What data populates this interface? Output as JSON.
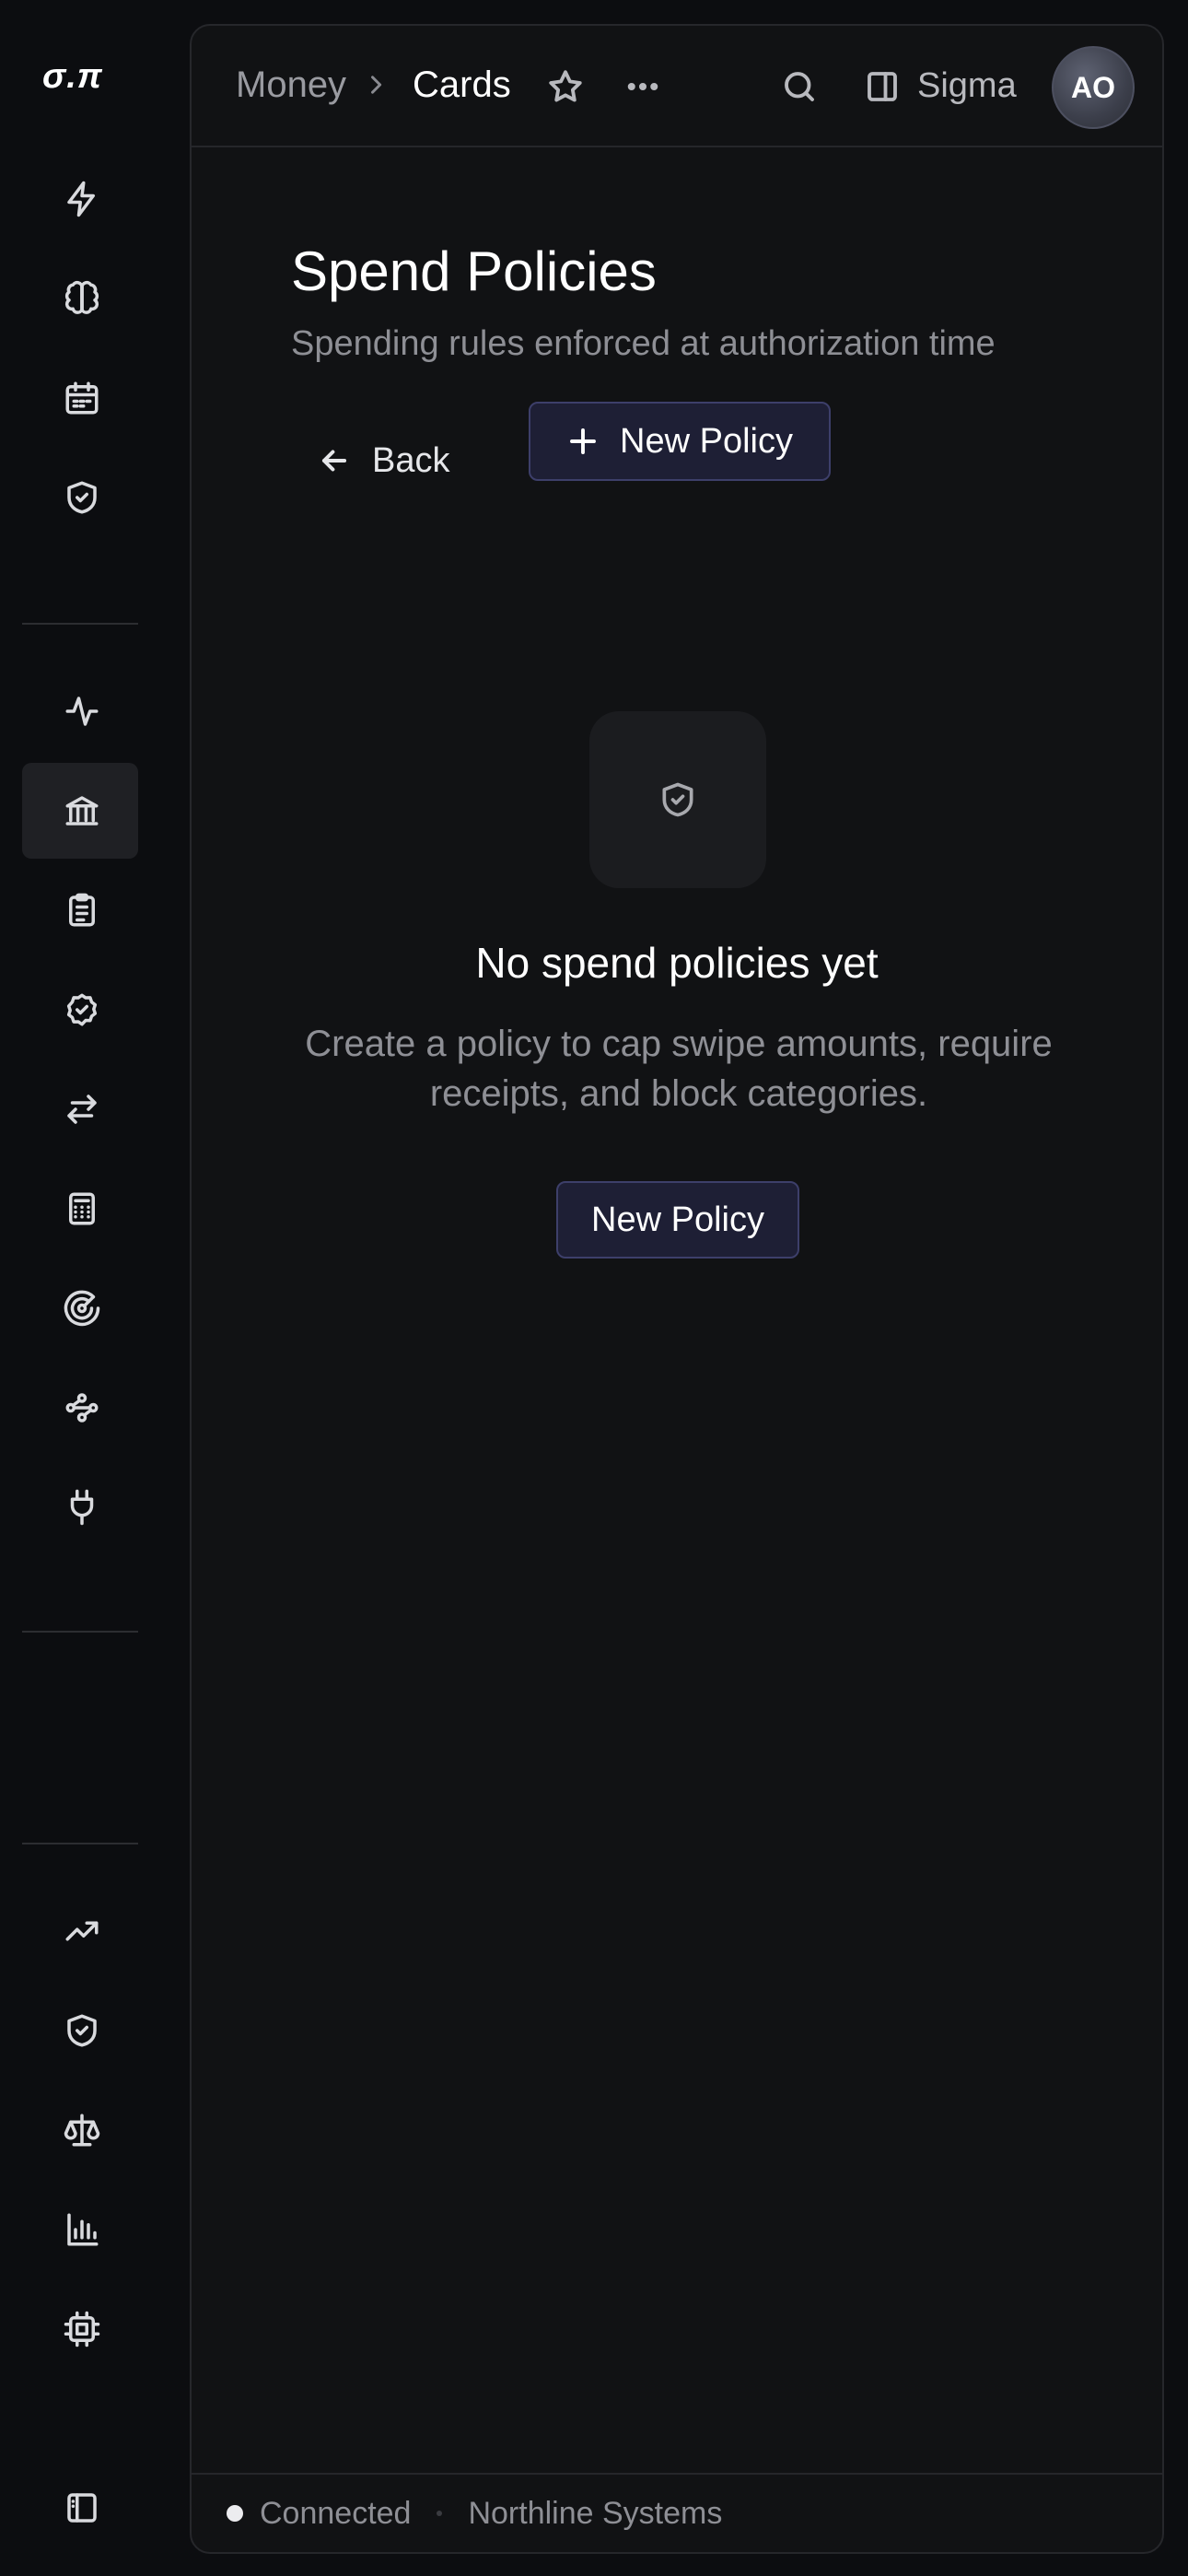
{
  "app": {
    "logo_text": "σ.π"
  },
  "sidebar": {
    "groups": [
      [
        "bolt-icon",
        "brain-icon",
        "calendar-icon",
        "shield-check-icon"
      ],
      [
        "activity-icon",
        "bank-icon",
        "clipboard-icon",
        "badge-check-icon",
        "transfer-icon",
        "calculator-icon",
        "radar-icon",
        "workflow-icon",
        "plug-icon"
      ],
      [
        "trending-up-icon",
        "shield-check-icon",
        "scale-icon",
        "bar-chart-icon",
        "chip-icon"
      ]
    ],
    "active": "bank-icon",
    "footer_icon": "sidebar-toggle-icon"
  },
  "header": {
    "breadcrumb_parent": "Money",
    "breadcrumb_current": "Cards",
    "workspace_label": "Sigma",
    "avatar_initials": "AO"
  },
  "page": {
    "title": "Spend Policies",
    "subtitle": "Spending rules enforced at authorization time",
    "back_label": "Back",
    "new_policy_label": "New Policy"
  },
  "empty_state": {
    "title": "No spend policies yet",
    "description": "Create a policy to cap swipe amounts, require receipts, and block categories.",
    "button_label": "New Policy"
  },
  "status": {
    "connection": "Connected",
    "organization": "Northline Systems"
  },
  "colors": {
    "accent_button_bg": "#1e1f35",
    "accent_button_border": "#3d3f6a",
    "background": "#0c0d10",
    "panel": "#111214"
  }
}
